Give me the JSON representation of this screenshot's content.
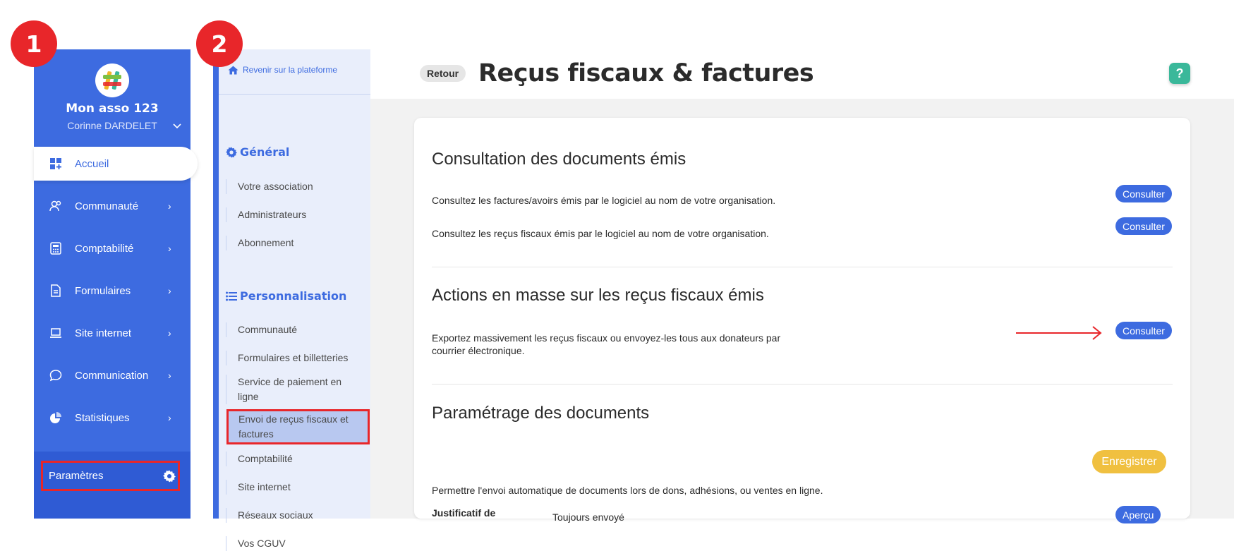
{
  "steps": [
    "1",
    "2"
  ],
  "sidebar": {
    "org_name": "Mon asso 123",
    "user_name": "Corinne DARDELET",
    "items": [
      {
        "label": "Accueil",
        "icon": "dashboard-icon"
      },
      {
        "label": "Communauté",
        "icon": "people-icon"
      },
      {
        "label": "Comptabilité",
        "icon": "calculator-icon"
      },
      {
        "label": "Formulaires",
        "icon": "document-icon"
      },
      {
        "label": "Site internet",
        "icon": "laptop-icon"
      },
      {
        "label": "Communication",
        "icon": "chat-icon"
      },
      {
        "label": "Statistiques",
        "icon": "pie-chart-icon"
      }
    ],
    "settings_label": "Paramètres"
  },
  "submenu": {
    "back_label": "Revenir sur la plateforme",
    "general_title": "Général",
    "general_items": [
      "Votre association",
      "Administrateurs",
      "Abonnement"
    ],
    "perso_title": "Personnalisation",
    "perso_items": [
      "Communauté",
      "Formulaires et billetteries",
      "Service de paiement en ligne",
      "Envoi de reçus fiscaux et factures",
      "Comptabilité",
      "Site internet",
      "Réseaux sociaux",
      "Vos CGUV"
    ]
  },
  "header": {
    "back_button": "Retour",
    "title": "Reçus fiscaux & factures",
    "help": "?"
  },
  "content": {
    "consultation": {
      "title": "Consultation des documents émis",
      "rows": [
        {
          "text": "Consultez les factures/avoirs émis par le logiciel au nom de votre organisation.",
          "button": "Consulter"
        },
        {
          "text": "Consultez les reçus fiscaux émis par le logiciel au nom de votre organisation.",
          "button": "Consulter"
        }
      ]
    },
    "actions": {
      "title": "Actions en masse sur les reçus fiscaux émis",
      "text_line1": "Exportez massivement les reçus fiscaux ou envoyez-les tous aux donateurs par",
      "text_line2": "courrier électronique.",
      "button": "Consulter"
    },
    "parametrage": {
      "title": "Paramétrage des documents",
      "save_button": "Enregistrer",
      "text": "Permettre l'envoi automatique de documents lors de dons, adhésions, ou ventes en ligne.",
      "row_label": "Justificatif de",
      "row_value": "Toujours envoyé",
      "row_button": "Aperçu"
    }
  },
  "colors": {
    "brand_blue": "#3d6be0",
    "highlight_red": "#e8262a",
    "save_yellow": "#f0c040",
    "help_green": "#3ab89a"
  }
}
